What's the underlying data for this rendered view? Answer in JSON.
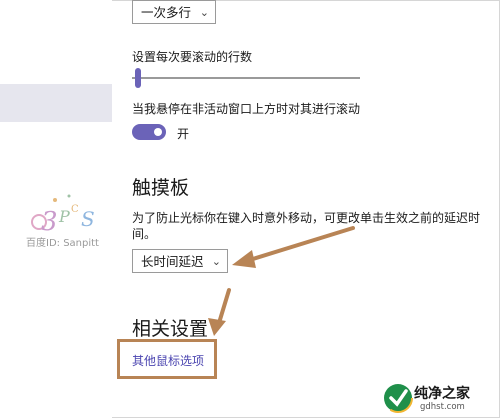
{
  "scroll_mode_dropdown": {
    "value": "一次多行"
  },
  "scroll_lines": {
    "label": "设置每次要滚动的行数",
    "value": 1
  },
  "inactive_scroll": {
    "label": "当我悬停在非活动窗口上方时对其进行滚动",
    "state": "开"
  },
  "touchpad": {
    "heading": "触摸板",
    "description": "为了防止光标你在键入时意外移动，可更改单击生效之前的延迟时间。",
    "delay_dropdown": {
      "value": "长时间延迟"
    }
  },
  "related": {
    "heading": "相关设置",
    "link": "其他鼠标选项"
  },
  "watermark": {
    "text": "百度ID: Sanpitt",
    "logo_text": "3PCS"
  },
  "brand": {
    "name": "纯净之家",
    "url": "gdhst.com"
  },
  "colors": {
    "accent": "#6b63b8",
    "annotation": "#b88455",
    "link": "#4b45b0"
  }
}
